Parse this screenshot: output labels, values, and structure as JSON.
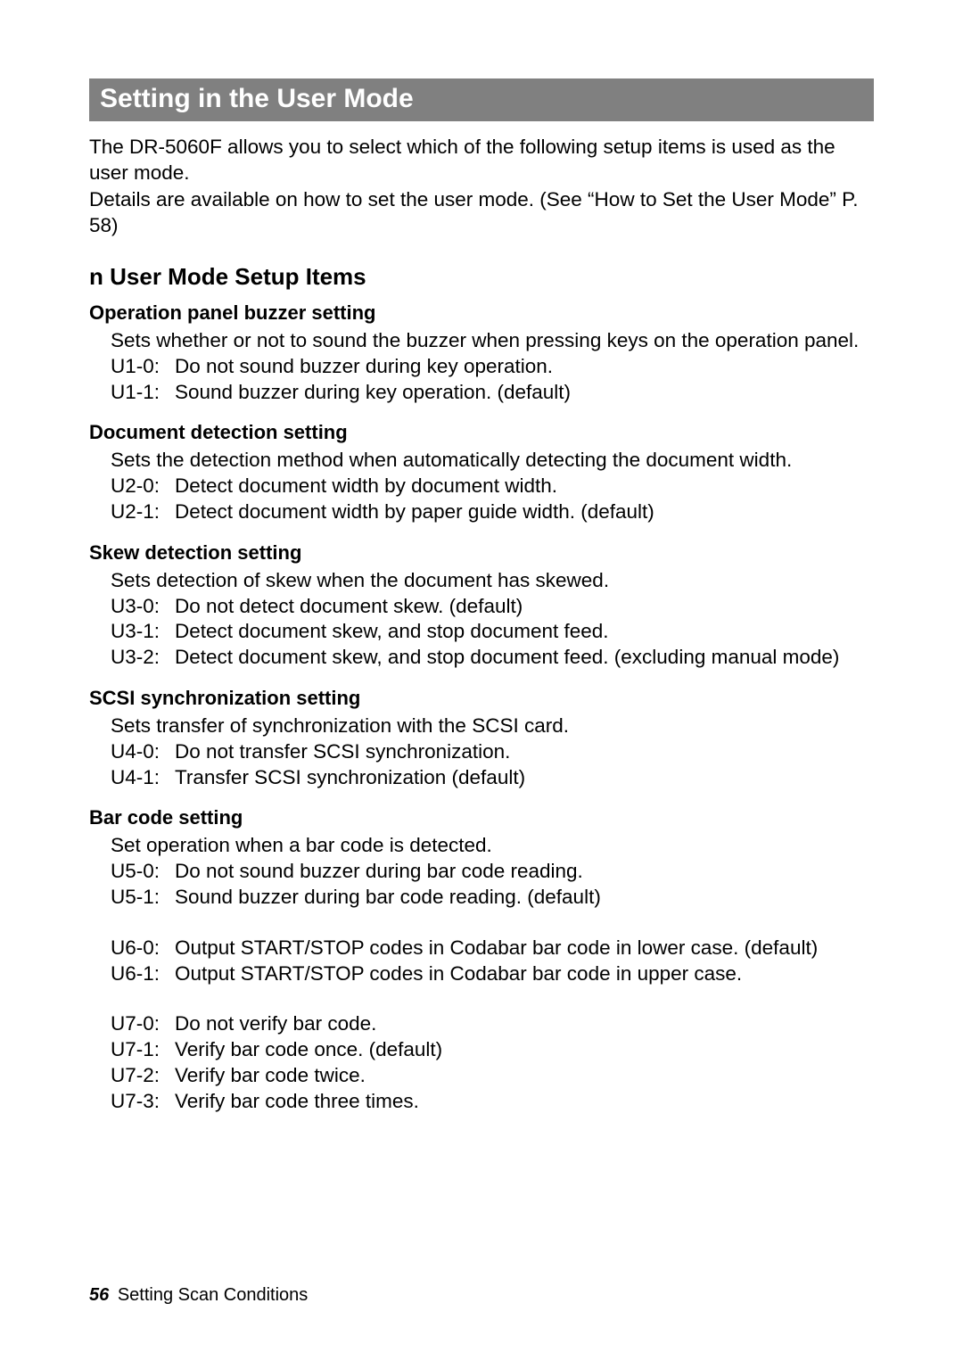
{
  "title": "Setting in the User Mode",
  "intro_p1": "The DR-5060F allows you to select which of the following setup items is used as the user mode.",
  "intro_p2": "Details are available on how to set the user mode. (See “How to Set the User Mode” P. 58)",
  "subheading_prefix": "n",
  "subheading": "User Mode Setup Items",
  "sections": [
    {
      "title": "Operation panel buzzer setting",
      "desc": "Sets whether or not to sound the buzzer when pressing keys on the operation panel.",
      "items": [
        {
          "k": "U1-0:",
          "v": "Do not sound buzzer during key operation."
        },
        {
          "k": "U1-1:",
          "v": "Sound buzzer during key operation. (default)"
        }
      ]
    },
    {
      "title": "Document detection setting",
      "desc": "Sets the detection method when automatically detecting the document width.",
      "items": [
        {
          "k": "U2-0:",
          "v": "Detect document width by document width."
        },
        {
          "k": "U2-1:",
          "v": "Detect document width by paper guide width. (default)"
        }
      ]
    },
    {
      "title": "Skew detection setting",
      "desc": "Sets detection of skew when the document has skewed.",
      "items": [
        {
          "k": "U3-0:",
          "v": "Do not detect document skew. (default)"
        },
        {
          "k": "U3-1:",
          "v": "Detect document skew, and stop document feed."
        },
        {
          "k": "U3-2:",
          "v": "Detect document skew, and stop document feed. (excluding manual mode)"
        }
      ]
    },
    {
      "title": "SCSI synchronization setting",
      "desc": "Sets transfer of synchronization with the SCSI card.",
      "items": [
        {
          "k": "U4-0:",
          "v": "Do not transfer SCSI synchronization."
        },
        {
          "k": "U4-1:",
          "v": "Transfer SCSI synchronization (default)"
        }
      ]
    },
    {
      "title": "Bar code setting",
      "desc": "Set operation when a bar code is detected.",
      "groups": [
        [
          {
            "k": "U5-0:",
            "v": "Do not sound buzzer during bar code reading."
          },
          {
            "k": "U5-1:",
            "v": "Sound buzzer during bar code reading. (default)"
          }
        ],
        [
          {
            "k": "U6-0:",
            "v": "Output START/STOP codes in Codabar bar code in lower case. (default)"
          },
          {
            "k": "U6-1:",
            "v": "Output START/STOP codes in Codabar bar code in upper case."
          }
        ],
        [
          {
            "k": "U7-0:",
            "v": "Do not verify bar code."
          },
          {
            "k": "U7-1:",
            "v": "Verify bar code once. (default)"
          },
          {
            "k": "U7-2:",
            "v": "Verify bar code twice."
          },
          {
            "k": "U7-3:",
            "v": "Verify bar code three times."
          }
        ]
      ]
    }
  ],
  "footer_page": "56",
  "footer_text": "Setting Scan Conditions"
}
